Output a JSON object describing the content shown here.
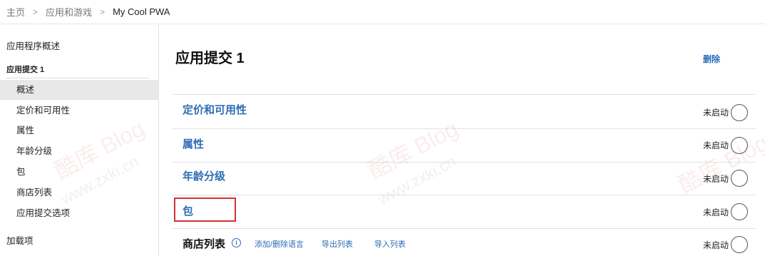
{
  "breadcrumb": {
    "home": "主页",
    "apps_games": "应用和游戏",
    "current": "My Cool PWA",
    "separator": ">"
  },
  "sidebar": {
    "overview": "应用程序概述",
    "section_title": "应用提交 1",
    "items": [
      {
        "label": "概述",
        "selected": true
      },
      {
        "label": "定价和可用性",
        "selected": false
      },
      {
        "label": "属性",
        "selected": false
      },
      {
        "label": "年龄分级",
        "selected": false
      },
      {
        "label": "包",
        "selected": false
      },
      {
        "label": "商店列表",
        "selected": false
      },
      {
        "label": "应用提交选项",
        "selected": false
      }
    ],
    "addons": "加载项"
  },
  "main": {
    "title": "应用提交 1",
    "delete_label": "删除",
    "rows": [
      {
        "title": "定价和可用性",
        "status": "未启动"
      },
      {
        "title": "属性",
        "status": "未启动"
      },
      {
        "title": "年龄分级",
        "status": "未启动"
      },
      {
        "title": "包",
        "status": "未启动"
      },
      {
        "title": "商店列表",
        "status": "未启动"
      }
    ],
    "store_links": {
      "info_icon": "i",
      "add_remove_language": "添加/删除语言",
      "export_list": "导出列表",
      "import_list": "导入列表"
    }
  },
  "watermark": {
    "brand": "酷库 Blog",
    "url": "www.zxki.cn"
  },
  "colors": {
    "link_blue": "#2e6db4",
    "highlight_red": "#d23232",
    "selected_bg": "#e8e8e8"
  }
}
